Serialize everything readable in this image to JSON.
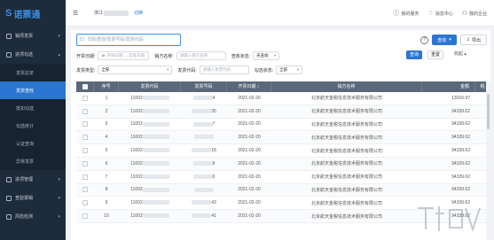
{
  "app": {
    "logo_text": "诺票通",
    "logo_mark": "S"
  },
  "sidebar": {
    "groups": [
      {
        "label": "销项发票",
        "expanded": false
      },
      {
        "label": "进项勾选",
        "expanded": true
      }
    ],
    "sub_items": [
      {
        "label": "发票总览",
        "active": false
      },
      {
        "label": "发票查收",
        "active": true
      },
      {
        "label": "抵扣勾选",
        "active": false
      },
      {
        "label": "勾选统计",
        "active": false
      },
      {
        "label": "认证查询",
        "active": false
      },
      {
        "label": "异常发票",
        "active": false
      }
    ],
    "bottom_groups": [
      {
        "label": "进项管理"
      },
      {
        "label": "查验报销"
      },
      {
        "label": "风险检测"
      }
    ]
  },
  "topbar": {
    "company_prefix": "浙江",
    "switch_label": "切换",
    "actions": [
      {
        "icon": "question-circle-icon",
        "label": "我的服务"
      },
      {
        "icon": "bell-icon",
        "label": "消息中心"
      },
      {
        "icon": "user-icon",
        "label": "我的企业"
      }
    ]
  },
  "toolbar": {
    "search_placeholder": "扫码查验/发票号码/发票代码",
    "help_label": "?",
    "check_label": "查收",
    "check_dropdown": "▾",
    "export_label": "导出"
  },
  "filters": {
    "issue_date_label": "开票日期:",
    "start_placeholder": "开始日期",
    "sep": "~",
    "end_placeholder": "结束日期",
    "seller_label": "销方名称:",
    "seller_placeholder": "请输入销方名称",
    "receive_status_label": "查收状态:",
    "receive_status_value": "未查收",
    "invoice_type_label": "发票类型:",
    "invoice_type_value": "全部",
    "invoice_code_label": "发票代码:",
    "invoice_code_placeholder": "请输入发票代码",
    "check_status_label": "勾选状态:",
    "check_status_value": "全部",
    "query_label": "查询",
    "reset_label": "重置",
    "collapse_label": "收起 ▴"
  },
  "table": {
    "headers": [
      "序号",
      "发票代码",
      "发票号码",
      "开票日期 ↕",
      "销方名称",
      "金额",
      "税"
    ],
    "rows": [
      {
        "seq": "1",
        "code": "11002",
        "num": "4",
        "date": "2021-02-20",
        "seller": "北京航天金税信息技术服务有限公司",
        "amount": "13016.97"
      },
      {
        "seq": "2",
        "code": "11002",
        "num": "35",
        "date": "2021-02-20",
        "seller": "北京航天金税信息技术服务有限公司",
        "amount": "94339.62"
      },
      {
        "seq": "3",
        "code": "11002",
        "num": "7",
        "date": "2021-02-20",
        "seller": "北京航天金税信息技术服务有限公司",
        "amount": "94339.62"
      },
      {
        "seq": "4",
        "code": "11002",
        "num": "",
        "date": "2021-02-20",
        "seller": "北京航天金税信息技术服务有限公司",
        "amount": "94339.62"
      },
      {
        "seq": "5",
        "code": "11002",
        "num": "18",
        "date": "2021-02-20",
        "seller": "北京航天金税信息技术服务有限公司",
        "amount": "94339.62"
      },
      {
        "seq": "6",
        "code": "11002",
        "num": "9",
        "date": "2021-02-20",
        "seller": "北京航天金税信息技术服务有限公司",
        "amount": "94339.62"
      },
      {
        "seq": "7",
        "code": "11002",
        "num": "0",
        "date": "2021-02-20",
        "seller": "北京航天金税信息技术服务有限公司",
        "amount": "94339.62"
      },
      {
        "seq": "8",
        "code": "11002",
        "num": "",
        "date": "2021-02-20",
        "seller": "北京航天金税信息技术服务有限公司",
        "amount": "94339.62"
      },
      {
        "seq": "9",
        "code": "11002",
        "num": "43",
        "date": "2021-02-20",
        "seller": "北京航天金税信息技术服务有限公司",
        "amount": "94339.62"
      },
      {
        "seq": "10",
        "code": "11002",
        "num": "41",
        "date": "2021-02-20",
        "seller": "北京航天金税信息技术服务有限公司",
        "amount": "94339.62"
      }
    ]
  }
}
